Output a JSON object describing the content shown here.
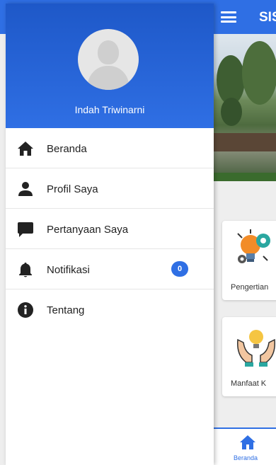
{
  "app": {
    "title": "SIS",
    "cards": [
      {
        "label": "Pengertian"
      },
      {
        "label": "Manfaat K"
      }
    ],
    "bottom_nav": {
      "home_label": "Beranda"
    }
  },
  "drawer": {
    "user_name": "Indah Triwinarni",
    "items": [
      {
        "label": "Beranda",
        "icon": "home-icon"
      },
      {
        "label": "Profil Saya",
        "icon": "person-icon"
      },
      {
        "label": "Pertanyaan Saya",
        "icon": "chat-icon"
      },
      {
        "label": "Notifikasi",
        "icon": "bell-icon",
        "badge": "0"
      },
      {
        "label": "Tentang",
        "icon": "info-icon"
      }
    ]
  },
  "colors": {
    "primary": "#2f6fe4",
    "icon": "#222222"
  }
}
